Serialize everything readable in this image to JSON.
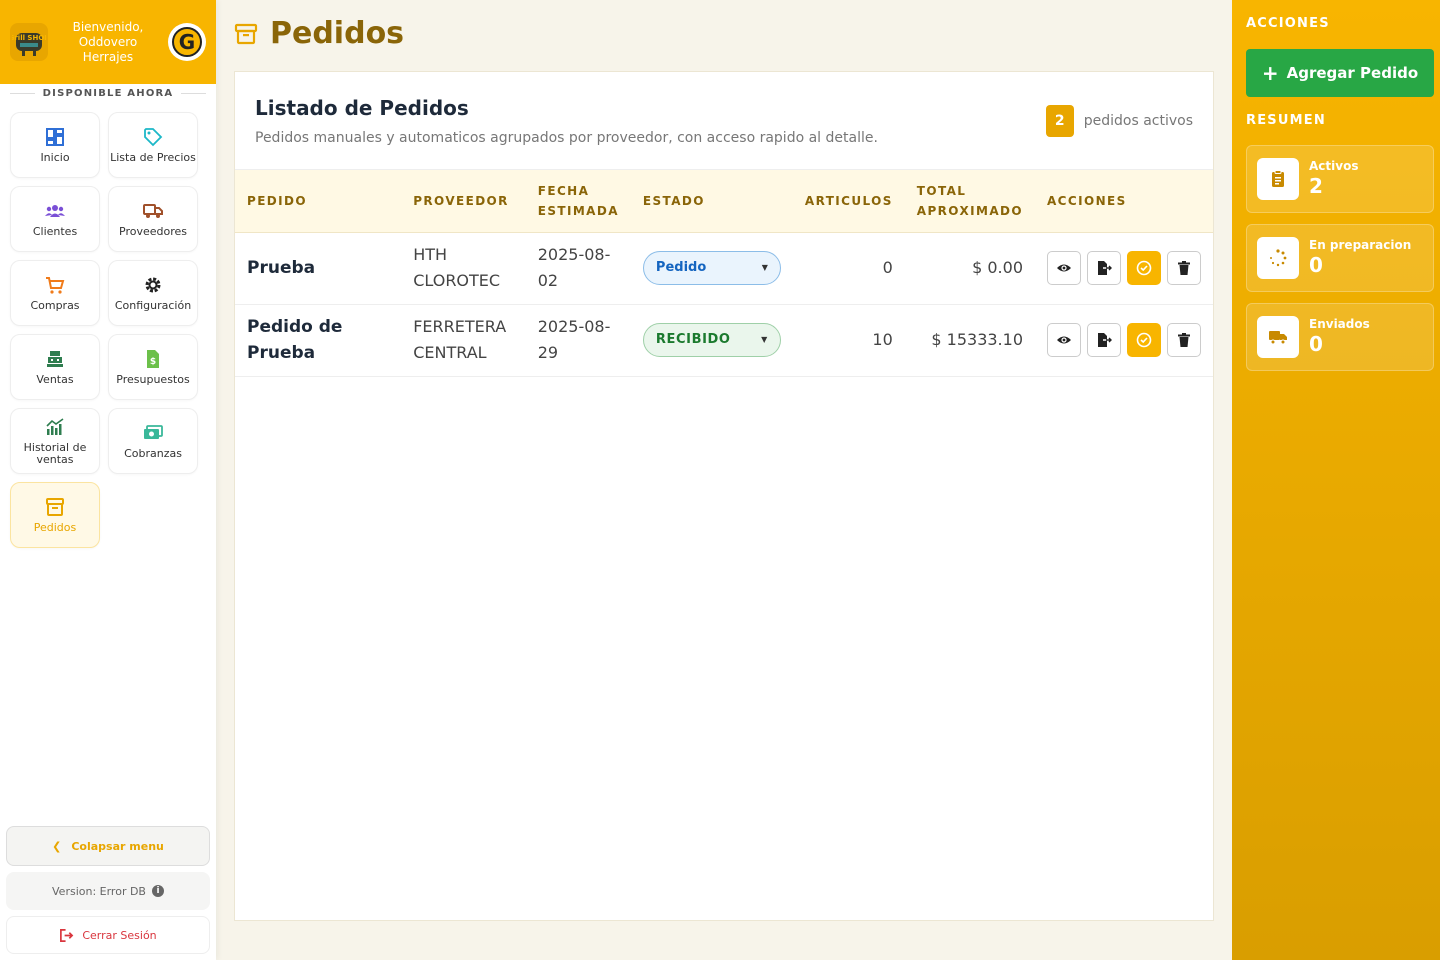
{
  "sidebar": {
    "welcome": "Bienvenido, Oddovero Herrajes",
    "logo_left_text": "Grill SHOP",
    "logo_right_text": "G",
    "section_label": "DISPONIBLE AHORA",
    "items": [
      {
        "label": "Inicio",
        "icon": "dashboard-icon"
      },
      {
        "label": "Lista de Precios",
        "icon": "tag-icon"
      },
      {
        "label": "Clientes",
        "icon": "users-icon"
      },
      {
        "label": "Proveedores",
        "icon": "truck-icon"
      },
      {
        "label": "Compras",
        "icon": "cart-icon"
      },
      {
        "label": "Configuración",
        "icon": "gear-icon"
      },
      {
        "label": "Ventas",
        "icon": "cash-register-icon"
      },
      {
        "label": "Presupuestos",
        "icon": "invoice-icon"
      },
      {
        "label": "Historial de ventas",
        "icon": "chart-icon"
      },
      {
        "label": "Cobranzas",
        "icon": "money-icon"
      },
      {
        "label": "Pedidos",
        "icon": "archive-icon"
      }
    ],
    "collapse_label": "Colapsar menu",
    "version": "Version: Error DB",
    "logout": "Cerrar Sesión"
  },
  "main": {
    "title": "Pedidos",
    "card_title": "Listado de Pedidos",
    "card_subtitle": "Pedidos manuales y automaticos agrupados por proveedor, con acceso rapido al detalle.",
    "active_count": "2",
    "active_label": "pedidos activos",
    "columns": [
      "PEDIDO",
      "PROVEEDOR",
      "FECHA ESTIMADA",
      "ESTADO",
      "ARTICULOS",
      "TOTAL APROXIMADO",
      "ACCIONES"
    ],
    "rows": [
      {
        "pedido": "Prueba",
        "proveedor": "HTH CLOROTEC",
        "fecha": "2025-08-02",
        "estado": "Pedido",
        "articulos": "0",
        "total": "$ 0.00"
      },
      {
        "pedido": "Pedido de Prueba",
        "proveedor": "FERRETERA CENTRAL",
        "fecha": "2025-08-29",
        "estado": "RECIBIDO",
        "articulos": "10",
        "total": "$ 15333.10"
      }
    ]
  },
  "right": {
    "acciones_label": "ACCIONES",
    "add_button": "Agregar Pedido",
    "resumen_label": "RESUMEN",
    "stats": [
      {
        "label": "Activos",
        "value": "2",
        "icon": "clipboard-icon"
      },
      {
        "label": "En preparacion",
        "value": "0",
        "icon": "spinner-icon"
      },
      {
        "label": "Enviados",
        "value": "0",
        "icon": "truck-icon"
      }
    ]
  },
  "colors": {
    "brand": "#f8b500",
    "brand_dark": "#8a6508",
    "success": "#28a745",
    "danger": "#d9363e"
  }
}
